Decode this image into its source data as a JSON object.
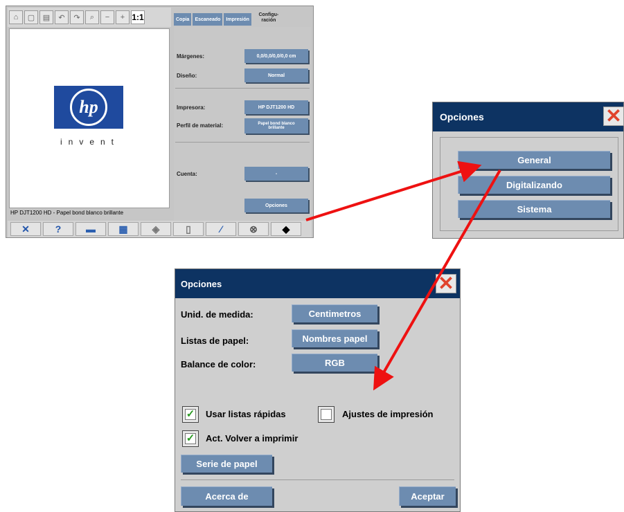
{
  "main_window": {
    "toolbar_fit_label": "1:1",
    "tabs": [
      "Copia",
      "Escaneado",
      "Impresión",
      "Configu-\nración"
    ],
    "config": {
      "margenes_label": "Márgenes:",
      "margenes_value": "0,0/0,0/0,0/0,0 cm",
      "diseno_label": "Diseño:",
      "diseno_value": "Normal",
      "impresora_label": "Impresora:",
      "impresora_value": "HP DJT1200 HD",
      "perfil_label": "Perfil de material:",
      "perfil_value": "Papel bond blanco brillante",
      "cuenta_label": "Cuenta:",
      "cuenta_value": "-",
      "opciones_button": "Opciones"
    },
    "logo_text": "hp",
    "logo_tagline": "invent",
    "status_text": "HP DJT1200 HD - Papel bond blanco brillante"
  },
  "options_small": {
    "title": "Opciones",
    "buttons": [
      "General",
      "Digitalizando",
      "Sistema"
    ]
  },
  "options_general": {
    "title": "Opciones",
    "unidad_label": "Unid. de medida:",
    "unidad_value": "Centimetros",
    "listas_label": "Listas de papel:",
    "listas_value": "Nombres papel",
    "balance_label": "Balance de color:",
    "balance_value": "RGB",
    "chk_rapidas_label": "Usar listas rápidas",
    "chk_rapidas_checked": true,
    "chk_ajustes_label": "Ajustes de impresión",
    "chk_ajustes_checked": false,
    "chk_volver_label": "Act. Volver a imprimir",
    "chk_volver_checked": true,
    "serie_button": "Serie de papel",
    "acerca_button": "Acerca de",
    "aceptar_button": "Aceptar"
  },
  "colors": {
    "accent_blue": "#6d8cb0",
    "header_navy": "#0d3362",
    "arrow_red": "#ee1111",
    "check_green": "#2a9a22"
  }
}
